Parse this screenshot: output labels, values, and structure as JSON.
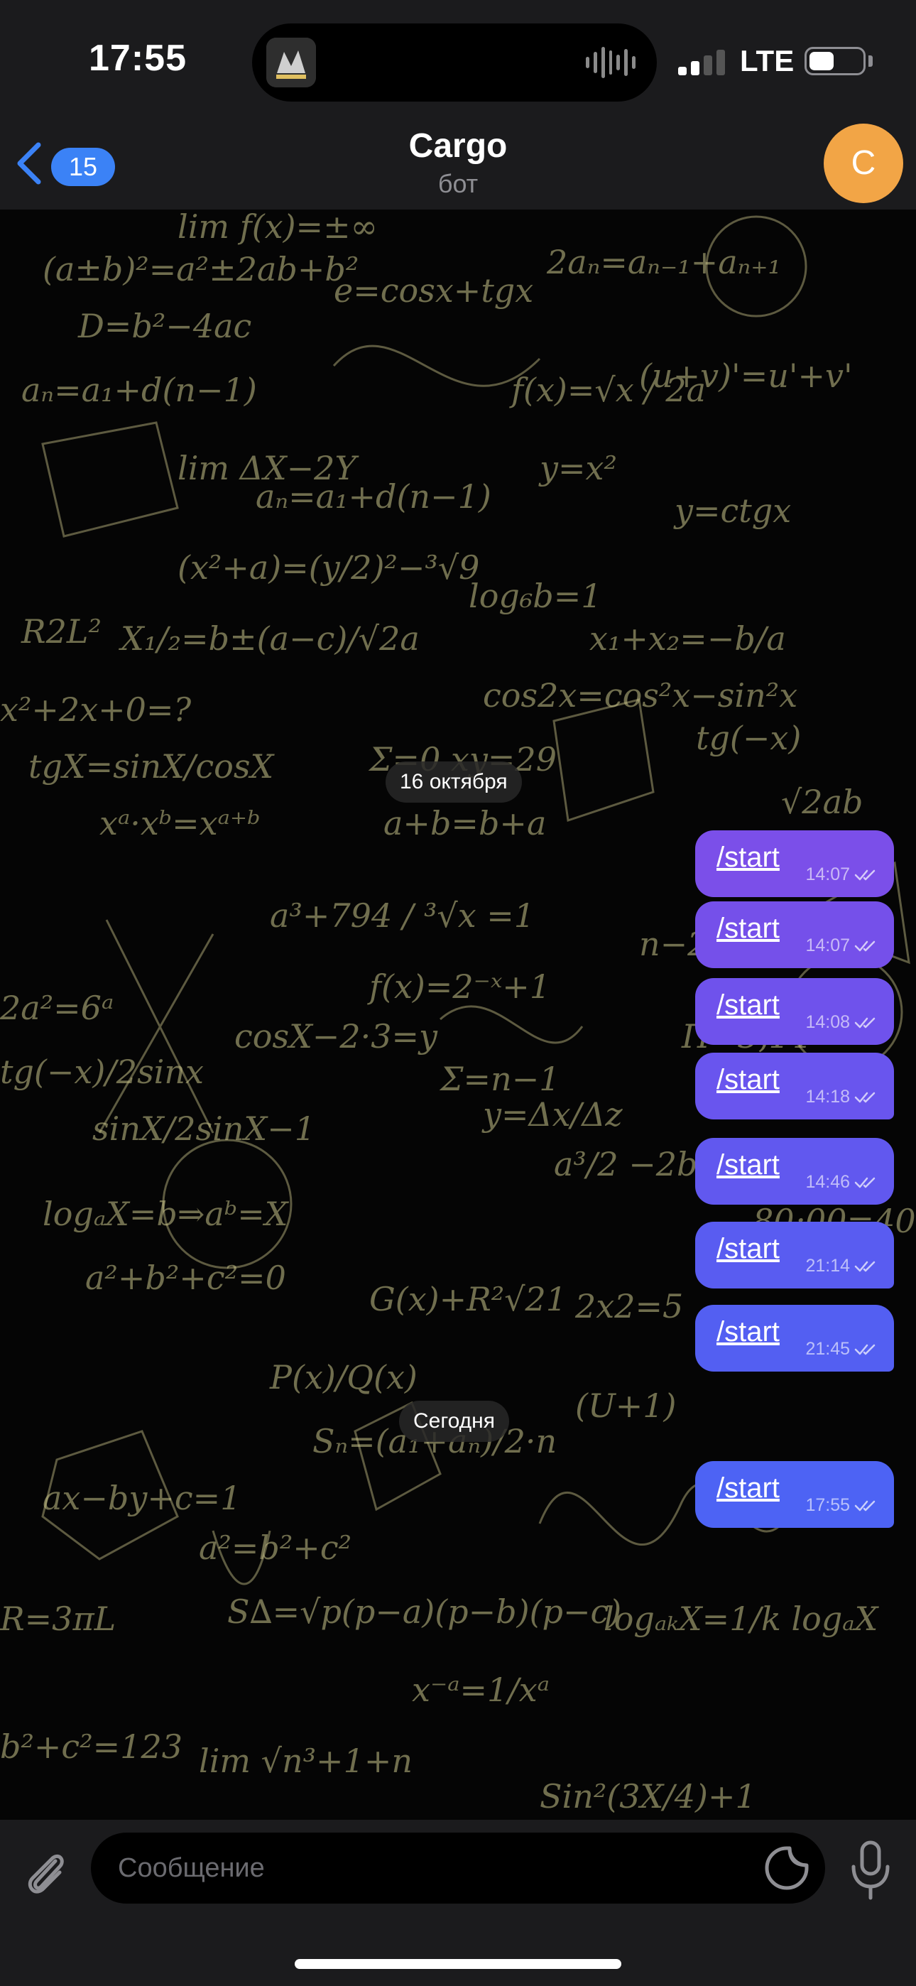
{
  "status_bar": {
    "time": "17:55",
    "network": "LTE",
    "signal_bars_active": 2,
    "signal_bars_total": 4,
    "battery_level": 0.42
  },
  "header": {
    "back_badge": "15",
    "title": "Cargo",
    "subtitle": "бот",
    "avatar_letter": "C",
    "avatar_color": "#f2a546"
  },
  "chat": {
    "groups": [
      {
        "date": "16 октября",
        "messages": [
          {
            "text": "/start",
            "time": "14:07",
            "color": "#7b4fe9"
          },
          {
            "text": "/start",
            "time": "14:07",
            "color": "#7550ea"
          },
          {
            "text": "/start",
            "time": "14:08",
            "color": "#6f52ec"
          },
          {
            "text": "/start",
            "time": "14:18",
            "color": "#6955ee"
          },
          {
            "text": "/start",
            "time": "14:46",
            "color": "#6158ef"
          },
          {
            "text": "/start",
            "time": "21:14",
            "color": "#595cf1"
          },
          {
            "text": "/start",
            "time": "21:45",
            "color": "#535ff2"
          }
        ]
      },
      {
        "date": "Сегодня",
        "messages": [
          {
            "text": "/start",
            "time": "17:55",
            "color": "#4d63f4"
          }
        ]
      }
    ]
  },
  "input": {
    "placeholder": "Сообщение"
  },
  "icons": {
    "back": "chevron-left-icon",
    "attach": "paperclip-icon",
    "sticker": "sticker-icon",
    "mic": "microphone-icon",
    "read": "double-check-icon"
  }
}
